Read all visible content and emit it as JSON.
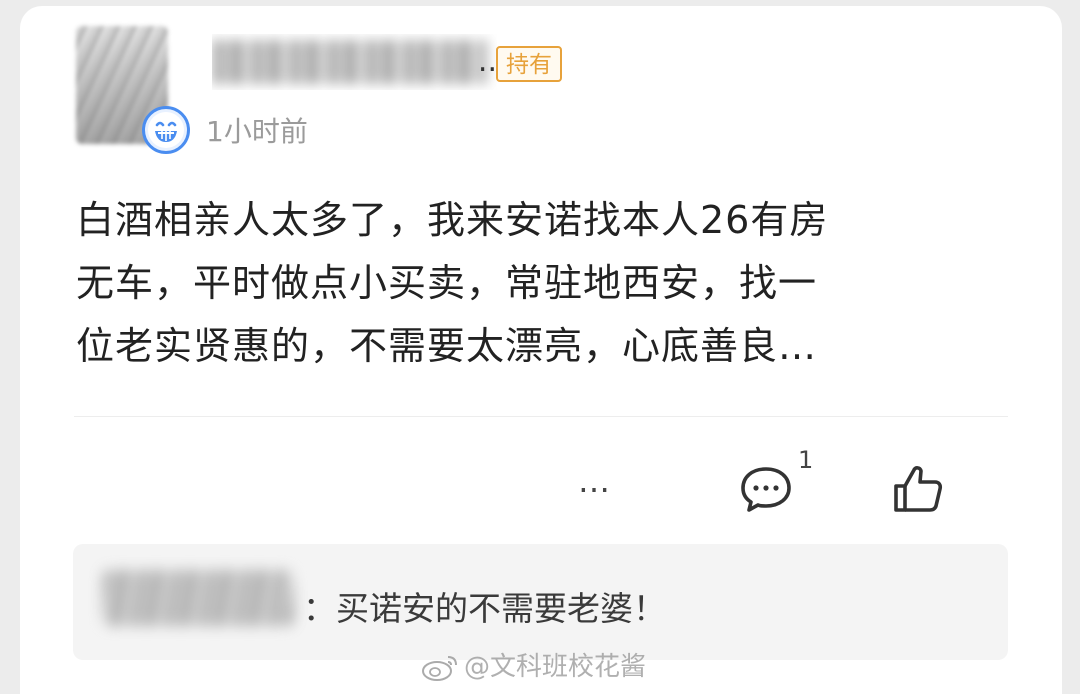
{
  "post": {
    "author_tail": "..",
    "holding_tag": "持有",
    "time": "1小时前",
    "content_lines": [
      "白酒相亲人太多了，我来安诺找本人26有房",
      "无车，平时做点小买卖，常驻地西安，找一",
      "位老实贤惠的，不需要太漂亮，心底善良…"
    ],
    "actions": {
      "more_label": "…",
      "comment_count": "1"
    }
  },
  "reply": {
    "text": "：买诺安的不需要老婆！"
  },
  "watermark": {
    "text": "@文科班校花酱"
  },
  "colors": {
    "tag": "#e7a23b",
    "badge": "#4a8df0",
    "time": "#9b9b9b"
  },
  "icons": {
    "avatar_badge": "grinning-face-icon",
    "comment": "comment-bubble-icon",
    "like": "thumbs-up-icon",
    "watermark_logo": "weibo-logo-icon"
  }
}
